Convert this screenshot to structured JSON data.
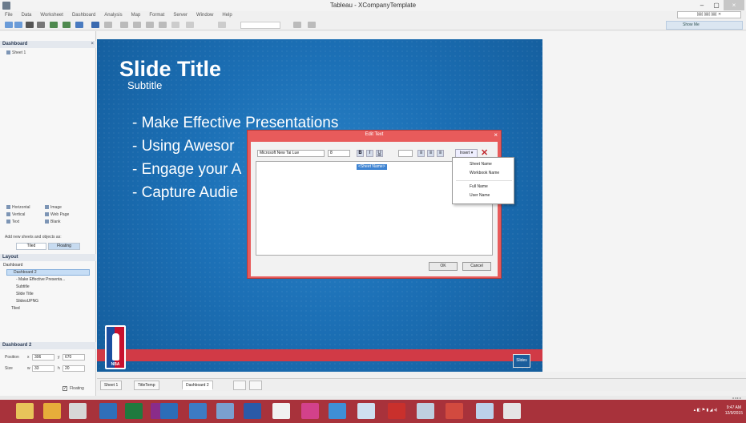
{
  "window": {
    "title": "Tableau - XCompanyTemplate",
    "min": "–",
    "max": "▢",
    "close": "×"
  },
  "menu": [
    "File",
    "Data",
    "Worksheet",
    "Dashboard",
    "Analysis",
    "Map",
    "Format",
    "Server",
    "Window",
    "Help"
  ],
  "menu_right": "|▤| |▤| |▤| ✕",
  "show_me": "Show Me",
  "dashboard_pane": {
    "header": "Dashboard",
    "close": "×",
    "sheets": [
      "Sheet 1"
    ],
    "objects": [
      {
        "label": "Horizontal",
        "icon": "horizontal-icon"
      },
      {
        "label": "Image",
        "icon": "image-icon"
      },
      {
        "label": "Vertical",
        "icon": "vertical-icon"
      },
      {
        "label": "Web Page",
        "icon": "web-page-icon"
      },
      {
        "label": "Text",
        "icon": "text-icon"
      },
      {
        "label": "Blank",
        "icon": "blank-icon"
      }
    ],
    "add_note": "Add new sheets and objects as:",
    "tiled": "Tiled",
    "floating": "Floating"
  },
  "layout_pane": {
    "header": "Layout",
    "items": [
      "Dashboard",
      "Dashboard 2",
      "- Make Effective Presenta...",
      "Subtitle",
      "Slide Title",
      "SlidesUPNG",
      "Tiled"
    ]
  },
  "dashboard2_pane": {
    "header": "Dashboard 2",
    "position_label": "Position",
    "x_label": "x",
    "x_value": "306",
    "y_label": "y",
    "y_value": "670",
    "size_label": "Size",
    "w_label": "w",
    "w_value": "33",
    "h_label": "h",
    "h_value": "20",
    "floating": "Floating",
    "floating_checked": "✓"
  },
  "slide": {
    "title": "Slide Title",
    "subtitle": "Subtitle",
    "bullets": [
      "- Make Effective Presentations",
      "- Using Awesor",
      "- Engage your A",
      "- Capture Audie"
    ],
    "logo_text": "NBA",
    "badge": "Slides"
  },
  "edit_text_dialog": {
    "title": "Edit Text",
    "close": "×",
    "font": "Microsoft New Tai Lue",
    "size": "8",
    "bold": "B",
    "italic": "I",
    "underline": "U",
    "align": [
      "≡",
      "≡",
      "≡"
    ],
    "insert": "Insert ▾",
    "clear": "✕",
    "token": "<Sheet Name>",
    "ok": "OK",
    "cancel": "Cancel"
  },
  "insert_menu": {
    "group1": [
      "Sheet Name",
      "Workbook Name"
    ],
    "group2": [
      "Full Name",
      "User Name"
    ]
  },
  "sheet_tabs": [
    "Sheet 1",
    "TitleTemp",
    "Dashboard 2"
  ],
  "status": "◂ ◂ ▸ ▸",
  "taskbar": {
    "clock_time": "9:47 AM",
    "clock_date": "12/9/2015"
  },
  "colors": {
    "slide_blue": "#1a6db2",
    "accent_red": "#d13a46",
    "taskbar": "#a8323b",
    "dialog_border": "#e85b5b"
  }
}
